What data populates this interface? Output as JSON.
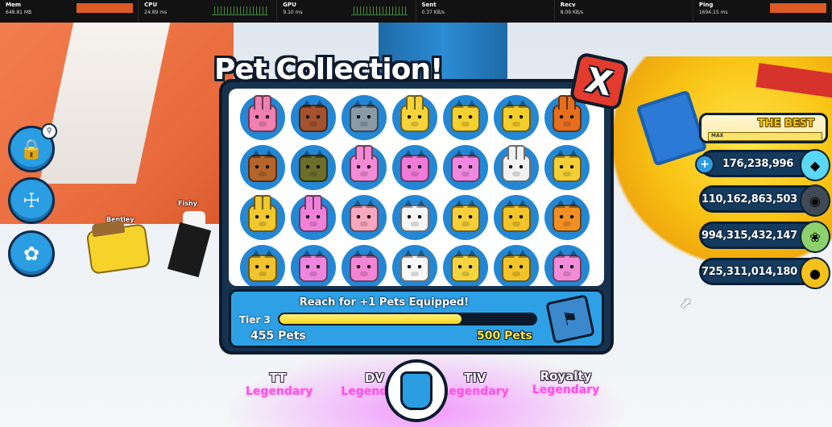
{
  "stats_bar": {
    "items": [
      {
        "label": "Mem",
        "value": "648.81 MB"
      },
      {
        "label": "CPU",
        "value": "24.89 ms"
      },
      {
        "label": "GPU",
        "value": "9.10 ms"
      },
      {
        "label": "Sent",
        "value": "0.37 KB/s"
      },
      {
        "label": "Recv",
        "value": "8.09 KB/s"
      },
      {
        "label": "Ping",
        "value": "1694.15 ms"
      }
    ]
  },
  "world": {
    "nametags": [
      "Bentley",
      "Fishy"
    ]
  },
  "modal": {
    "title": "Pet Collection!",
    "close_label": "X",
    "pets": [
      {
        "icon": "pink-bunny-icon",
        "color": "#f07fb2",
        "kind": "bunny"
      },
      {
        "icon": "brown-bear-icon",
        "color": "#a4532e",
        "kind": "cat"
      },
      {
        "icon": "gray-cat-icon",
        "color": "#8a9aa6",
        "kind": "cat"
      },
      {
        "icon": "golden-bunny-icon",
        "color": "#f6d33a",
        "kind": "bunny"
      },
      {
        "icon": "golden-dog-icon",
        "color": "#f4d030",
        "kind": "cat"
      },
      {
        "icon": "golden-cat-icon",
        "color": "#f2cd2c",
        "kind": "cat"
      },
      {
        "icon": "orange-bunny-icon",
        "color": "#e56e1f",
        "kind": "bunny"
      },
      {
        "icon": "brown-cat-icon",
        "color": "#b5652a",
        "kind": "cat"
      },
      {
        "icon": "olive-cat-icon",
        "color": "#6c6e2a",
        "kind": "cat"
      },
      {
        "icon": "pink-bunny-icon",
        "color": "#f38ad6",
        "kind": "bunny"
      },
      {
        "icon": "pink-dog-icon",
        "color": "#f17ad8",
        "kind": "cat"
      },
      {
        "icon": "pink-cat-icon",
        "color": "#f087e0",
        "kind": "cat"
      },
      {
        "icon": "white-bunny-icon",
        "color": "#f1f1f1",
        "kind": "bunny"
      },
      {
        "icon": "golden-cat-icon",
        "color": "#f3cf35",
        "kind": "cat"
      },
      {
        "icon": "golden-bunny-icon",
        "color": "#f1c92c",
        "kind": "bunny"
      },
      {
        "icon": "pink-bunny-icon",
        "color": "#f081da",
        "kind": "bunny"
      },
      {
        "icon": "pink-pig-icon",
        "color": "#f7a7bf",
        "kind": "cat"
      },
      {
        "icon": "cow-icon",
        "color": "#f5f5f5",
        "kind": "cat"
      },
      {
        "icon": "golden-monkey-icon",
        "color": "#f5ce3a",
        "kind": "cat"
      },
      {
        "icon": "golden-pig-icon",
        "color": "#f2c42a",
        "kind": "cat"
      },
      {
        "icon": "orange-pig-icon",
        "color": "#f09024",
        "kind": "cat"
      },
      {
        "icon": "golden-bear-icon",
        "color": "#f1c32d",
        "kind": "cat"
      },
      {
        "icon": "pink-cat-icon",
        "color": "#ee86e0",
        "kind": "cat"
      },
      {
        "icon": "pink-pig-icon",
        "color": "#f286d4",
        "kind": "cat"
      },
      {
        "icon": "chicken-icon",
        "color": "#f8f8f8",
        "kind": "cat"
      },
      {
        "icon": "golden-chick-icon",
        "color": "#f4d540",
        "kind": "cat"
      },
      {
        "icon": "golden-chick-icon",
        "color": "#f2c42b",
        "kind": "cat"
      },
      {
        "icon": "pink-pig-icon",
        "color": "#f28bd8",
        "kind": "cat"
      }
    ],
    "progress": {
      "heading": "Reach for +1 Pets Equipped!",
      "tier": "Tier 3",
      "current": "455 Pets",
      "target": "500 Pets",
      "fraction": 0.71,
      "reward_icon": "cat-flag-icon"
    }
  },
  "hud": {
    "rank": {
      "title": "THE BEST",
      "max_label": "MAX",
      "fraction": 1.0
    },
    "currencies": [
      {
        "value": "176,238,996",
        "icon": "diamond-icon",
        "color": "#59d7f5",
        "has_plus": true
      },
      {
        "value": "110,162,863,503",
        "icon": "dark-coin-icon",
        "color": "#3f4a55",
        "has_plus": false
      },
      {
        "value": "994,315,432,147",
        "icon": "candy-coin-icon",
        "color": "#8cd16d",
        "has_plus": false
      },
      {
        "value": "725,311,014,180",
        "icon": "gold-coin-icon",
        "color": "#f2c21a",
        "has_plus": false
      }
    ]
  },
  "bottom": {
    "labels": [
      {
        "name": "TT",
        "rarity": "Legendary"
      },
      {
        "name": "DV",
        "rarity": "Legendary"
      },
      {
        "name": "TIV",
        "rarity": "Legendary"
      },
      {
        "name": "Royalty",
        "rarity": "Legendary"
      }
    ]
  },
  "colors": {
    "panel_dark": "#17324f",
    "accent_blue": "#2ea1e6",
    "progress_yellow": "#f6d51c",
    "close_red": "#e33b2d",
    "legendary_pink": "#ff4fe6"
  }
}
